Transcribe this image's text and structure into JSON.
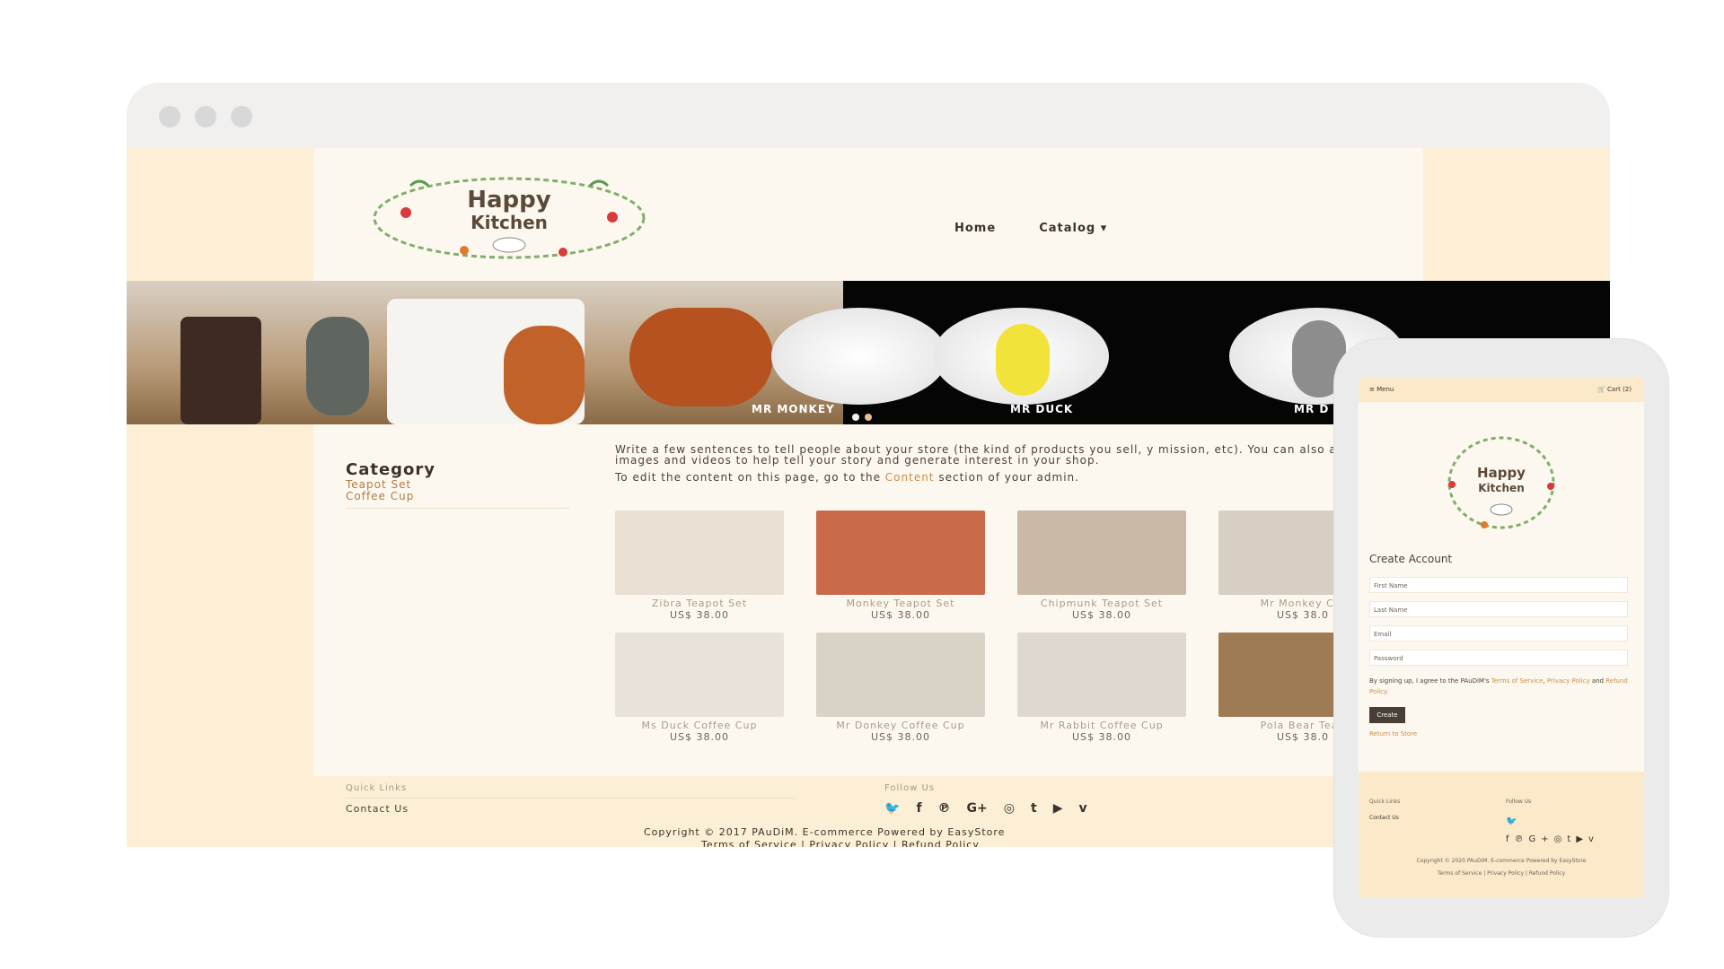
{
  "site": {
    "logo_text_1": "Happy",
    "logo_text_2": "Kitchen"
  },
  "nav": {
    "home": "Home",
    "catalog": "Catalog"
  },
  "banner": {
    "captions": [
      "MR MONKEY",
      "MR DUCK",
      "MR D"
    ]
  },
  "sidebar": {
    "title": "Category",
    "links": [
      "Teapot Set",
      "Coffee Cup"
    ]
  },
  "intro": {
    "p1": "Write a few sentences to tell people about your store (the kind of products you sell, y mission, etc). You can also add images and videos to help tell your story and generate interest in your shop.",
    "p2_before": "To edit the content on this page, go to the ",
    "p2_link": "Content",
    "p2_after": " section of your admin."
  },
  "products": [
    {
      "name": "Zibra Teapot Set",
      "price": "US$ 38.00",
      "color": "#e9dfd2"
    },
    {
      "name": "Monkey Teapot Set",
      "price": "US$ 38.00",
      "color": "#c96a4a"
    },
    {
      "name": "Chipmunk Teapot Set",
      "price": "US$ 38.00",
      "color": "#c9b9a6"
    },
    {
      "name": "Mr Monkey Cof",
      "price": "US$ 38.0",
      "color": "#d8cfc4"
    },
    {
      "name": "Ms Duck Coffee Cup",
      "price": "US$ 38.00",
      "color": "#e8e2d8"
    },
    {
      "name": "Mr Donkey Coffee Cup",
      "price": "US$ 38.00",
      "color": "#d9d2c6"
    },
    {
      "name": "Mr Rabbit Coffee Cup",
      "price": "US$ 38.00",
      "color": "#ded8ce"
    },
    {
      "name": "Pola Bear Teap",
      "price": "US$ 38.0",
      "color": "#9e7a55"
    }
  ],
  "footer": {
    "quick_links": "Quick Links",
    "contact": "Contact Us",
    "follow": "Follow Us",
    "social_icons": [
      "twitter-icon",
      "facebook-icon",
      "pinterest-icon",
      "google-plus-icon",
      "instagram-icon",
      "tumblr-icon",
      "youtube-icon",
      "vimeo-icon"
    ],
    "copyright": "Copyright © 2017 PAuDiM. E-commerce Powered by EasyStore",
    "policies": "Terms of Service | Privacy Policy | Refund Policy"
  },
  "mobile": {
    "menu": "Menu",
    "cart": "Cart (2)",
    "title": "Create Account",
    "first_name": "First Name",
    "last_name": "Last Name",
    "email": "Email",
    "password": "Password",
    "terms_prefix": "By signing up, I agree to the PAuDiM's ",
    "terms_tos": "Terms of Service",
    "terms_sep": ", ",
    "terms_privacy": "Privacy Policy",
    "terms_and": " and ",
    "terms_refund": "Refund Policy.",
    "create": "Create",
    "return": "Return to Store",
    "quick_links": "Quick Links",
    "contact": "Contact Us",
    "follow": "Follow Us",
    "copyright": "Copyright © 2020 PAuDiM. E-commerce Powered by EasyStore",
    "policies": "Terms of Service | Privacy Policy | Refund Policy"
  },
  "colors": {
    "accent": "#c98e47",
    "page_bg": "#fdf8ef",
    "outer_bg": "#fcefd6"
  }
}
